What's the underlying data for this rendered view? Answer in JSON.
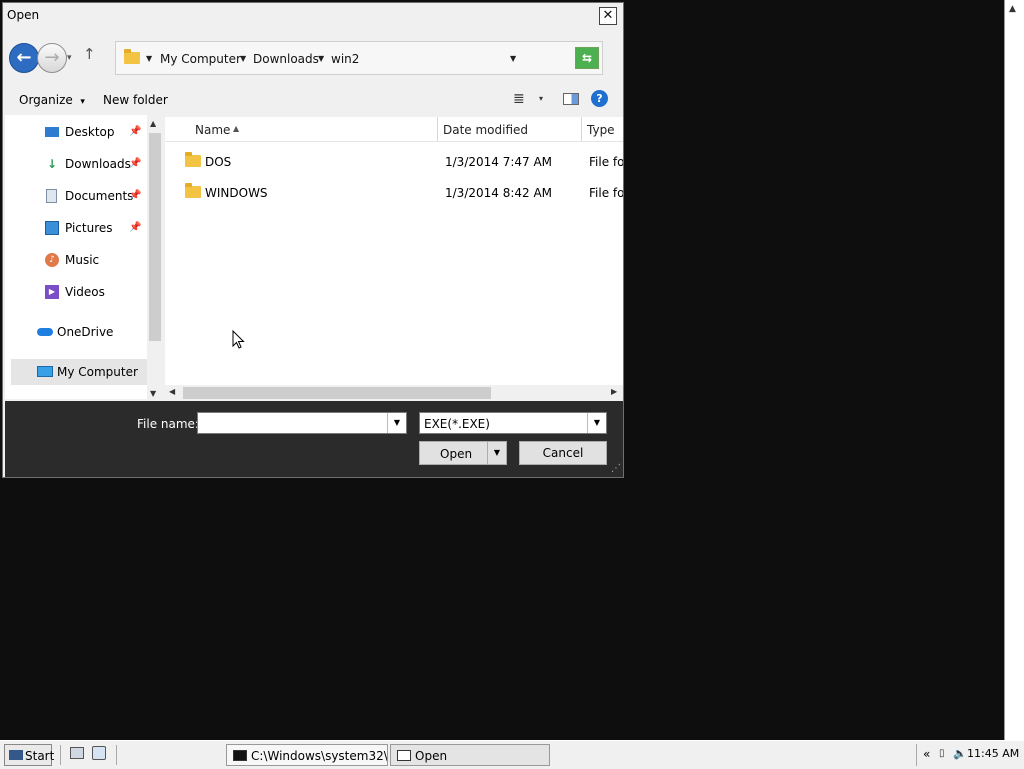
{
  "dialog": {
    "title": "Open",
    "close_glyph": "✕"
  },
  "nav": {
    "back_glyph": "←",
    "forward_glyph": "→",
    "history_glyph": "▾",
    "up_glyph": "↑"
  },
  "address": {
    "crumbs": [
      "My Computer",
      "Downloads",
      "win2"
    ],
    "caret": "▼",
    "refresh_glyph": "⇆"
  },
  "toolbar": {
    "organize": "Organize",
    "organize_caret": "▾",
    "new_folder": "New folder",
    "view_glyph": "≣",
    "view_caret": "▾",
    "help_glyph": "?"
  },
  "sidebar": {
    "items": [
      {
        "label": "Desktop",
        "icon": "desktop-icon",
        "pinned": true
      },
      {
        "label": "Downloads",
        "icon": "download-icon",
        "pinned": true
      },
      {
        "label": "Documents",
        "icon": "documents-icon",
        "pinned": true
      },
      {
        "label": "Pictures",
        "icon": "pictures-icon",
        "pinned": true
      },
      {
        "label": "Music",
        "icon": "music-icon",
        "pinned": false
      },
      {
        "label": "Videos",
        "icon": "videos-icon",
        "pinned": false
      },
      {
        "label": "OneDrive",
        "icon": "cloud-icon",
        "pinned": false
      },
      {
        "label": "My Computer",
        "icon": "computer-icon",
        "pinned": false,
        "selected": true
      }
    ],
    "pin_glyph": "📌"
  },
  "file_list": {
    "columns": [
      "Name",
      "Date modified",
      "Type"
    ],
    "sort_glyph": "▲",
    "rows": [
      {
        "name": "DOS",
        "date": "1/3/2014 7:47 AM",
        "type": "File folder"
      },
      {
        "name": "WINDOWS",
        "date": "1/3/2014 8:42 AM",
        "type": "File folder"
      }
    ]
  },
  "bottom": {
    "file_name_label": "File name:",
    "file_name_value": "",
    "filter": "EXE(*.EXE)",
    "dropdown_glyph": "▼",
    "open_label": "Open",
    "cancel_label": "Cancel",
    "grip_glyph": "⋰"
  },
  "taskbar": {
    "start_label": "Start",
    "tasks": [
      {
        "label": "C:\\Windows\\system32\\...",
        "icon": "console-icon"
      },
      {
        "label": "Open",
        "icon": "window-icon"
      }
    ],
    "tray_chevron": "«",
    "clock": "11:45 AM"
  },
  "colors": {
    "desktop": "#0e0e0e",
    "dialog_bg": "#f0f0f0",
    "bottom_panel": "#2b2b2b",
    "accent_blue": "#2d6cc0",
    "folder_yellow": "#f3c444",
    "refresh_green": "#4caf50"
  }
}
